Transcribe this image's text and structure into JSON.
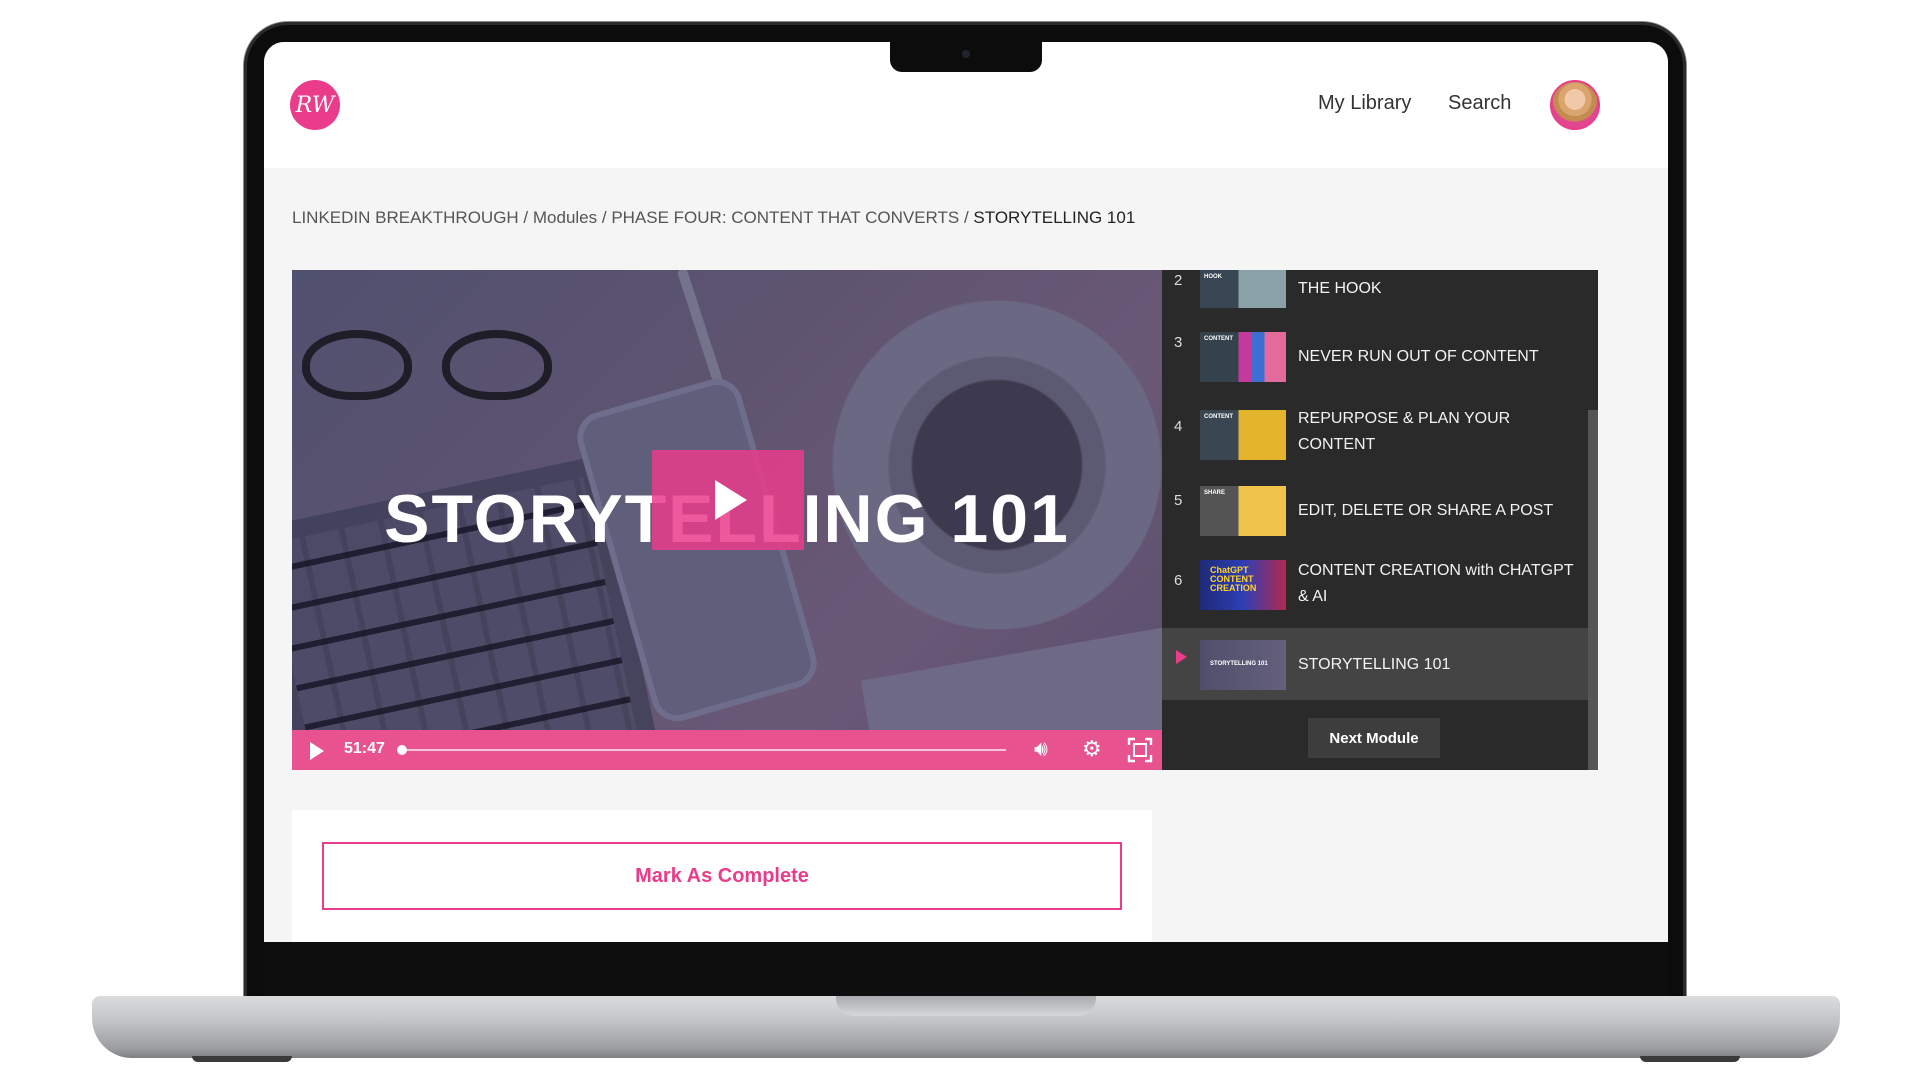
{
  "nav": {
    "logo_text": "RW",
    "my_library": "My Library",
    "search": "Search"
  },
  "breadcrumb": {
    "items": [
      "LINKEDIN BREAKTHROUGH",
      "Modules",
      "PHASE FOUR: CONTENT THAT CONVERTS"
    ],
    "separator": " / ",
    "current": "STORYTELLING 101"
  },
  "video": {
    "title": "STORYTELLING 101",
    "time": "51:47",
    "progress": 0.0
  },
  "playlist": {
    "items": [
      {
        "num": "2",
        "label": "THE HOOK",
        "thumb_text": "HOOK"
      },
      {
        "num": "3",
        "label": "NEVER RUN OUT OF CONTENT",
        "thumb_text": "CONTENT"
      },
      {
        "num": "4",
        "label": "REPURPOSE & PLAN YOUR CONTENT",
        "thumb_text": "CONTENT"
      },
      {
        "num": "5",
        "label": "EDIT, DELETE OR SHARE A POST",
        "thumb_text": "SHARE"
      },
      {
        "num": "6",
        "label": "CONTENT CREATION with CHATGPT & AI",
        "thumb_text": "ChatGPT CONTENT CREATION"
      },
      {
        "num": "",
        "label": "STORYTELLING 101",
        "thumb_text": "STORYTELLING 101",
        "active": true
      }
    ],
    "next_module": "Next Module"
  },
  "actions": {
    "mark_complete": "Mark As Complete"
  },
  "colors": {
    "accent": "#ea3c8b",
    "controls": "#e8528f",
    "playlist_bg": "#2a2a2a"
  }
}
